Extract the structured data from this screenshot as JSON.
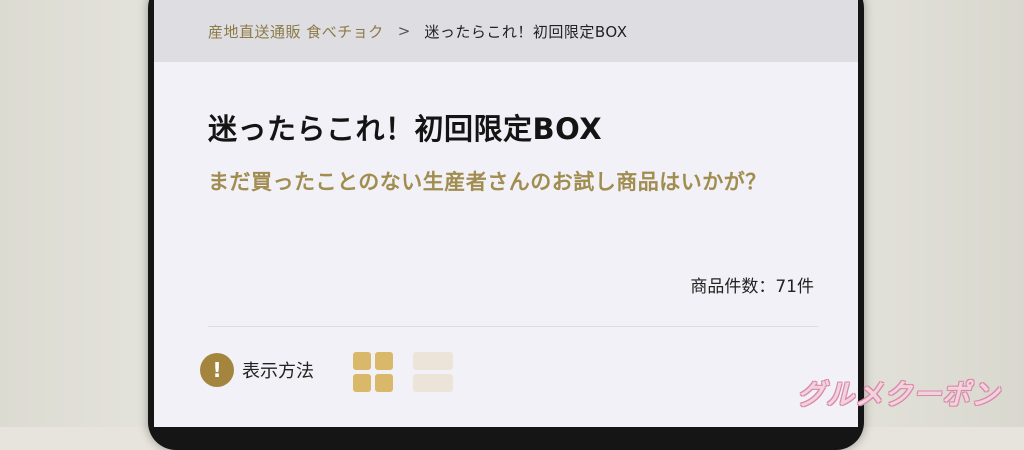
{
  "breadcrumb": {
    "home": "産地直送通販 食べチョク",
    "separator": ">",
    "current": "迷ったらこれ！初回限定BOX"
  },
  "page": {
    "title": "迷ったらこれ！初回限定BOX",
    "subtitle": "まだ買ったことのない生産者さんのお試し商品はいかが？",
    "item_count": "商品件数：71件"
  },
  "display": {
    "info_icon": "!",
    "label": "表示方法"
  },
  "watermark": "グルメクーポン",
  "colors": {
    "accent_gold": "#a18d4f",
    "grid_active": "#d9b86a",
    "list_inactive": "#ece4d8",
    "info_icon_bg": "#a4853d"
  }
}
